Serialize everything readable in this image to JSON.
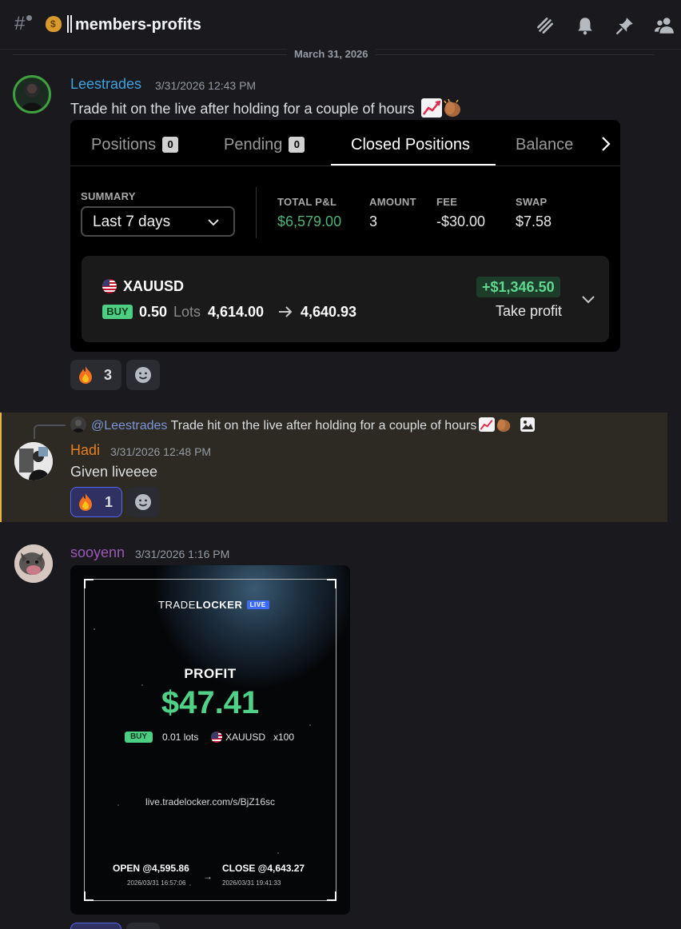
{
  "header": {
    "channel_emoji": "money-bag-icon",
    "channel_name": "members-profits",
    "icons": [
      "threads-icon",
      "bell-icon",
      "pin-icon",
      "members-icon"
    ]
  },
  "date_divider": "March 31, 2026",
  "messages": [
    {
      "username": "Leestrades",
      "username_color": "#3ca2e0",
      "timestamp": "3/31/2026 12:43 PM",
      "text": "Trade hit on the live after holding for a couple of hours",
      "reactions": [
        {
          "icon": "fire-icon",
          "count": "3"
        }
      ]
    },
    {
      "reply_to_user": "@Leestrades",
      "reply_text": "Trade hit on the live after holding for a couple of hours",
      "username": "Hadi",
      "username_color": "#e67e22",
      "timestamp": "3/31/2026 12:48 PM",
      "text": "Given liveeee",
      "reactions": [
        {
          "icon": "fire-icon",
          "count": "1"
        }
      ]
    },
    {
      "username": "sooyenn",
      "username_color": "#9b59b6",
      "timestamp": "3/31/2026 1:16 PM"
    }
  ],
  "trade_card": {
    "tabs": [
      {
        "label": "Positions",
        "badge": "0"
      },
      {
        "label": "Pending",
        "badge": "0"
      },
      {
        "label": "Closed Positions"
      },
      {
        "label": "Balance"
      }
    ],
    "summary_label": "SUMMARY",
    "summary_range": "Last 7 days",
    "stats": [
      {
        "label": "TOTAL P&L",
        "value": "$6,579.00"
      },
      {
        "label": "AMOUNT",
        "value": "3"
      },
      {
        "label": "FEE",
        "value": "-$30.00"
      },
      {
        "label": "SWAP",
        "value": "$7.58"
      }
    ],
    "position": {
      "symbol": "XAUUSD",
      "side": "BUY",
      "lots": "0.50",
      "lots_unit": "Lots",
      "open_price": "4,614.00",
      "close_price": "4,640.93",
      "pnl": "+$1,346.50",
      "close_reason": "Take profit"
    }
  },
  "tradelocker_share": {
    "brand_prefix": "TRADE",
    "brand_main": "LOCKER",
    "badge": "LIVE",
    "profit_label": "PROFIT",
    "profit_value": "$47.41",
    "side": "BUY",
    "lots": "0.01 lots",
    "symbol": "XAUUSD",
    "leverage": "x100",
    "url": "live.tradelocker.com/s/BjZ16sc",
    "open": "OPEN @4,595.86",
    "open_time": "2026/03/31 16:57:06",
    "close": "CLOSE @4,643.27",
    "close_time": "2026/03/31 19:41:33"
  },
  "colors": {
    "profit_green": "#4fd287",
    "mention_highlight": "#e8b341",
    "accent": "#5865f2"
  }
}
